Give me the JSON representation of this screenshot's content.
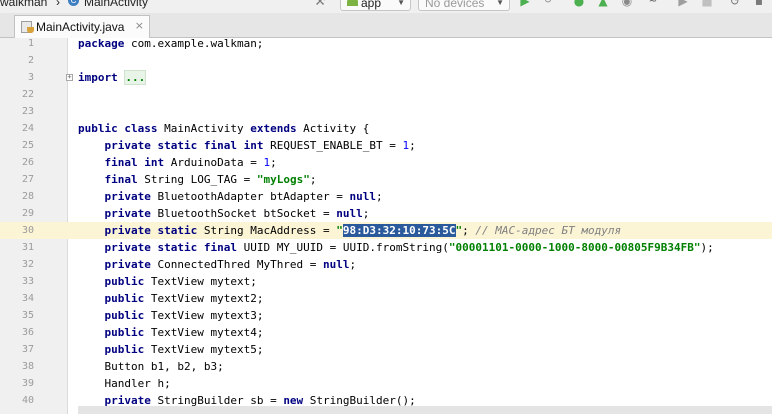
{
  "navbar": {
    "project": "walkman",
    "separator": "›",
    "class_icon": "C",
    "class_name": "MainActivity"
  },
  "toolbar": {
    "run_config": "app",
    "device": "No devices",
    "icons": [
      "hammer-icon",
      "android-icon",
      "run-icon",
      "apply-changes-icon",
      "debug-icon",
      "profile-icon",
      "attach-debugger-icon",
      "stop-icon",
      "sync-icon"
    ]
  },
  "tabs": [
    {
      "label": "MainActivity.java",
      "icon": "java-file-icon",
      "close": "×",
      "active": true
    }
  ],
  "colors": {
    "keyword": "#000080",
    "string": "#008000",
    "comment": "#808080",
    "number": "#0000ff",
    "selection": "#2a5a9c",
    "current_line": "#fbf5d6",
    "gutter": "#f0f0f0"
  },
  "editor": {
    "current_line": "30",
    "lines": {
      "l1": {
        "num": "1",
        "t1": "package",
        "t2": " com.example.walkman;"
      },
      "l2": {
        "num": "2"
      },
      "l3": {
        "num": "3",
        "t1": "import",
        "t2": "...",
        "fold": "+"
      },
      "l22": {
        "num": "22"
      },
      "l23": {
        "num": "23"
      },
      "l24": {
        "num": "24",
        "t1": "public class",
        "t2": " MainActivity ",
        "t3": "extends",
        "t4": " Activity {"
      },
      "l25": {
        "num": "25",
        "t1": "private static final int",
        "t2": " REQUEST_ENABLE_BT = ",
        "t3": "1",
        "t4": ";"
      },
      "l26": {
        "num": "26",
        "t1": "final int",
        "t2": " ArduinoData = ",
        "t3": "1",
        "t4": ";"
      },
      "l27": {
        "num": "27",
        "t1": "final",
        "t2": " String LOG_TAG = ",
        "t3": "\"myLogs\"",
        "t4": ";"
      },
      "l28": {
        "num": "28",
        "t1": "private",
        "t2": " BluetoothAdapter btAdapter = ",
        "t3": "null",
        "t4": ";"
      },
      "l29": {
        "num": "29",
        "t1": "private",
        "t2": " BluetoothSocket btSocket = ",
        "t3": "null",
        "t4": ";"
      },
      "l30": {
        "num": "30",
        "t1": "private static",
        "t2": " String MacAddress = ",
        "t3": "\"",
        "t4": "98:D3:32:10:73:5C",
        "t5": "\"",
        "t6": "; ",
        "t7": "// MAC-адрес БТ модуля"
      },
      "l31": {
        "num": "31",
        "t1": "private static final",
        "t2": " UUID MY_UUID = UUID.fromString(",
        "t3": "\"00001101-0000-1000-8000-00805F9B34FB\"",
        "t4": ");"
      },
      "l32": {
        "num": "32",
        "t1": "private",
        "t2": " ConnectedThred MyThred = ",
        "t3": "null",
        "t4": ";"
      },
      "l33": {
        "num": "33",
        "t1": "public",
        "t2": " TextView mytext;"
      },
      "l34": {
        "num": "34",
        "t1": "public",
        "t2": " TextView mytext2;"
      },
      "l35": {
        "num": "35",
        "t1": "public",
        "t2": " TextView mytext3;"
      },
      "l36": {
        "num": "36",
        "t1": "public",
        "t2": " TextView mytext4;"
      },
      "l37": {
        "num": "37",
        "t1": "public",
        "t2": " TextView mytext5;"
      },
      "l38": {
        "num": "38",
        "t1": "    Button b1, b2, b3;"
      },
      "l39": {
        "num": "39",
        "t1": "    Handler h;"
      },
      "l40": {
        "num": "40",
        "t1": "private",
        "t2": " StringBuilder sb = ",
        "t3": "new",
        "t4": " StringBuilder();"
      }
    }
  }
}
